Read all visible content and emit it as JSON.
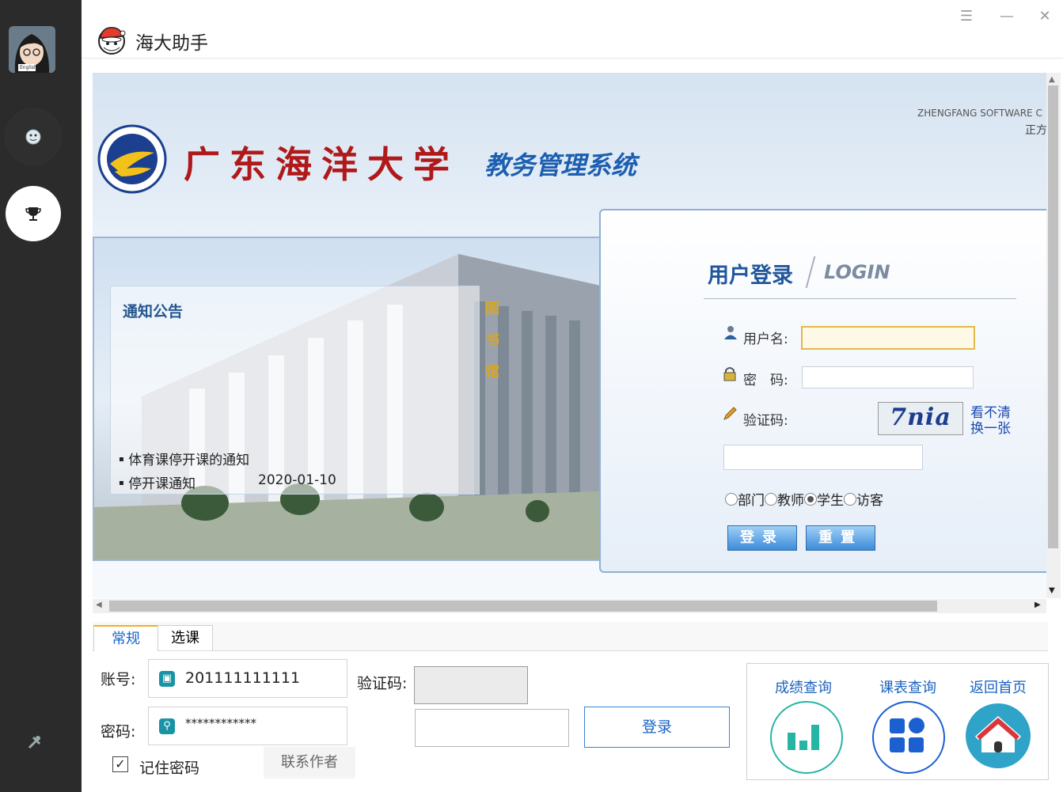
{
  "app": {
    "title": "海大助手"
  },
  "window": {
    "menu_glyph": "☰",
    "minimize_glyph": "—",
    "close_glyph": "✕"
  },
  "sidebar": {
    "avatar_text": "English",
    "items": [
      {
        "icon": "face-icon"
      },
      {
        "icon": "trophy-icon"
      }
    ],
    "bottom_icon": "tools-icon"
  },
  "web": {
    "school_name": "广东海洋大学",
    "system_name": "教务管理系统",
    "vendor_line1": "ZHENGFANG SOFTWARE C",
    "vendor_line2": "正方",
    "library_sign": "图书馆",
    "notice": {
      "title": "通知公告",
      "items": [
        {
          "text": "体育课停开课的通知",
          "date": ""
        },
        {
          "text": "停开课通知",
          "date": "2020-01-10"
        }
      ]
    },
    "login": {
      "title": "用户登录",
      "subtitle": "LOGIN",
      "username_label": "用户名:",
      "password_label": "密　码:",
      "captcha_label": "验证码:",
      "captcha_text": "7nia",
      "captcha_refresh_line1": "看不清",
      "captcha_refresh_line2": "换一张",
      "roles": [
        "部门",
        "教师",
        "学生",
        "访客"
      ],
      "selected_role": "学生",
      "login_button": "登录",
      "reset_button": "重置"
    }
  },
  "bottom": {
    "tabs": [
      {
        "label": "常规",
        "active": true
      },
      {
        "label": "选课",
        "active": false
      }
    ],
    "account_label": "账号:",
    "account_value": "201111111111",
    "password_label": "密码:",
    "password_value": "************",
    "captcha_label": "验证码:",
    "captcha_input_value": "",
    "login_button": "登录",
    "remember_label": "记住密码",
    "remember_checked": true,
    "contact_button": "联系作者",
    "quick": [
      {
        "label": "成绩查询",
        "icon": "bar-chart-icon",
        "color": "#26b5a5"
      },
      {
        "label": "课表查询",
        "icon": "grid-icon",
        "color": "#1b5fd0"
      },
      {
        "label": "返回首页",
        "icon": "home-icon",
        "color": "#2fa3c8"
      }
    ]
  },
  "colors": {
    "sidebar": "#2b2b2b",
    "accent": "#1664c8",
    "school_red": "#b01919",
    "tab_highlight": "#f0b020"
  }
}
